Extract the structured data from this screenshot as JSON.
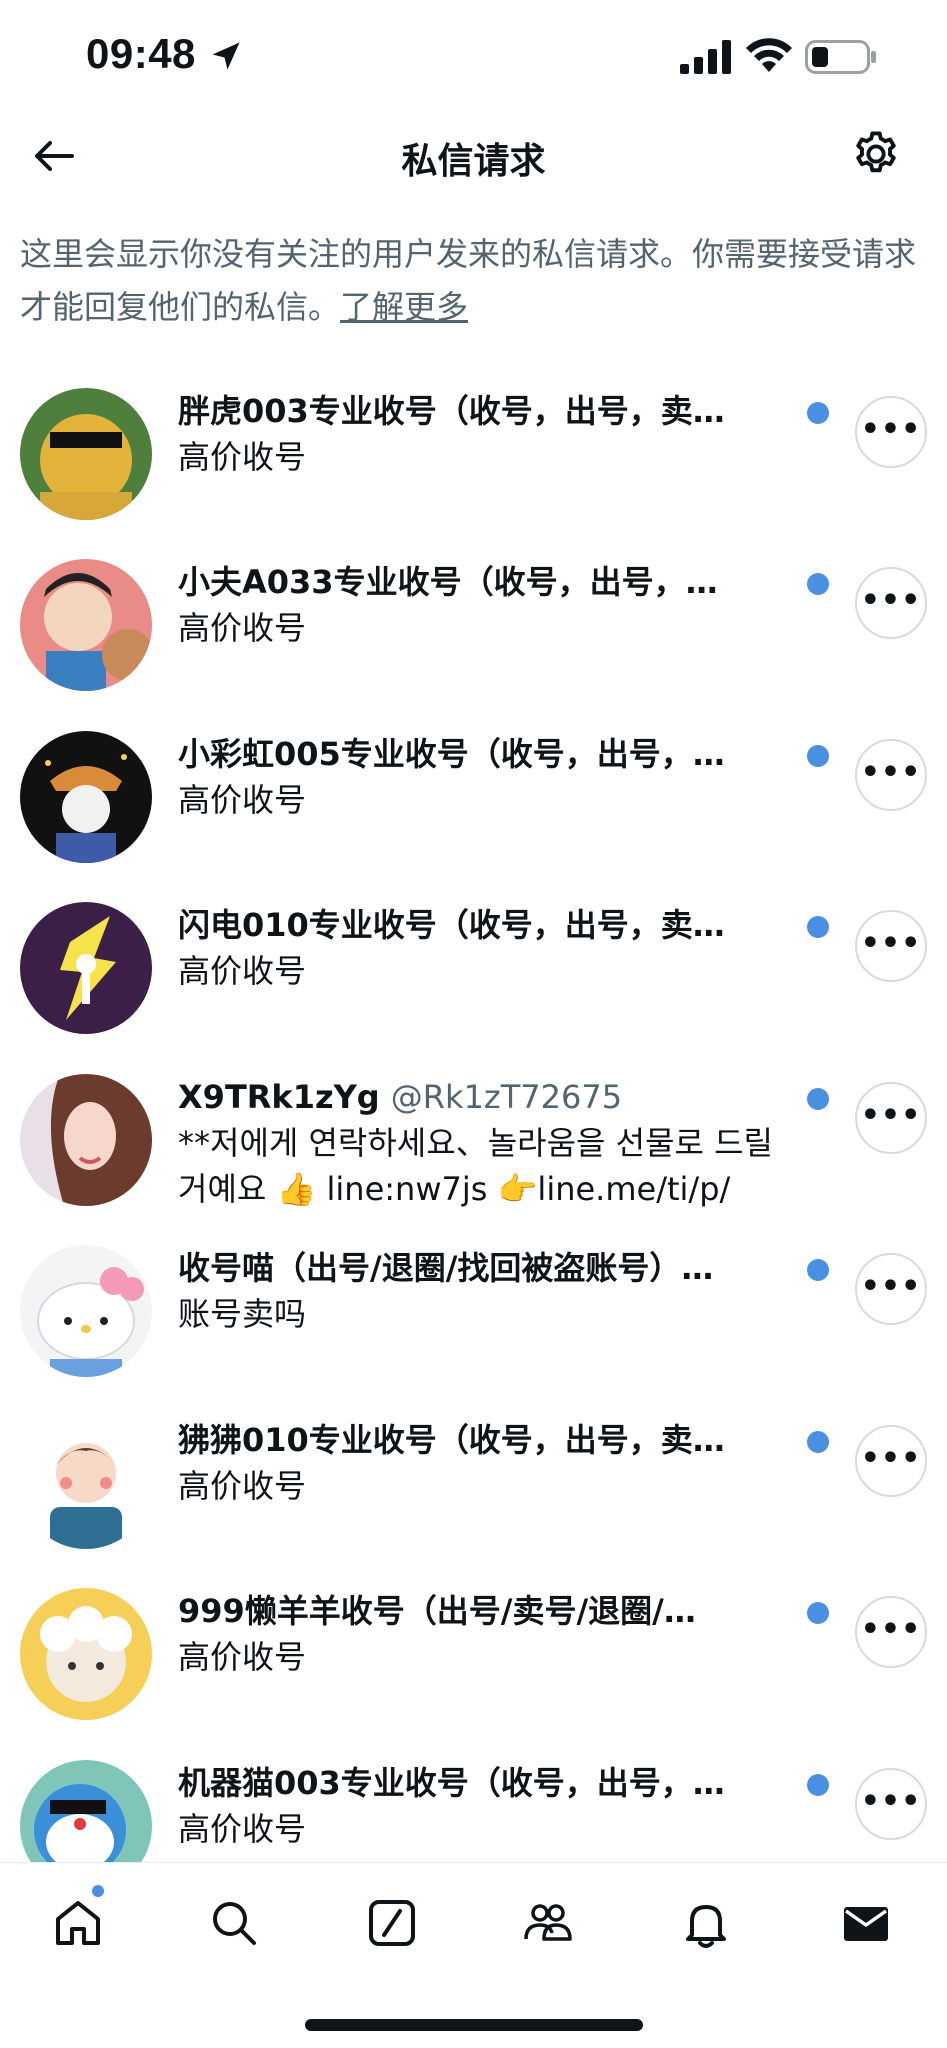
{
  "status_bar": {
    "time": "09:48"
  },
  "header": {
    "title": "私信请求"
  },
  "info": {
    "text": "这里会显示你没有关注的用户发来的私信请求。你需要接受请求才能回复他们的私信。",
    "link": "了解更多"
  },
  "requests": [
    {
      "name": "胖虎003专业收号（收号，出号，卖…",
      "handle": "",
      "message": "高价收号"
    },
    {
      "name": "小夫A033专业收号（收号，出号，…",
      "handle": "",
      "message": "高价收号"
    },
    {
      "name": "小彩虹005专业收号（收号，出号，…",
      "handle": "",
      "message": "高价收号"
    },
    {
      "name": "闪电010专业收号（收号，出号，卖…",
      "handle": "",
      "message": "高价收号"
    },
    {
      "name": "X9TRk1zYg",
      "handle": "@Rk1zT72675",
      "message": "**저에게 연락하세요、놀라움을 선물로 드릴 거예요 👍 line:nw7js 👉line.me/ti/p/"
    },
    {
      "name": "收号喵（出号/退圈/找回被盗账号）…",
      "handle": "",
      "message": "账号卖吗"
    },
    {
      "name": "狒狒010专业收号（收号，出号，卖…",
      "handle": "",
      "message": "高价收号"
    },
    {
      "name": "999懒羊羊收号（出号/卖号/退圈/…",
      "handle": "",
      "message": "高价收号"
    },
    {
      "name": "机器猫003专业收号（收号，出号，…",
      "handle": "",
      "message": "高价收号"
    }
  ],
  "more_label": "•••",
  "colors": {
    "accent": "#4a90e2",
    "secondary_text": "#536471",
    "primary_text": "#0f1419"
  }
}
